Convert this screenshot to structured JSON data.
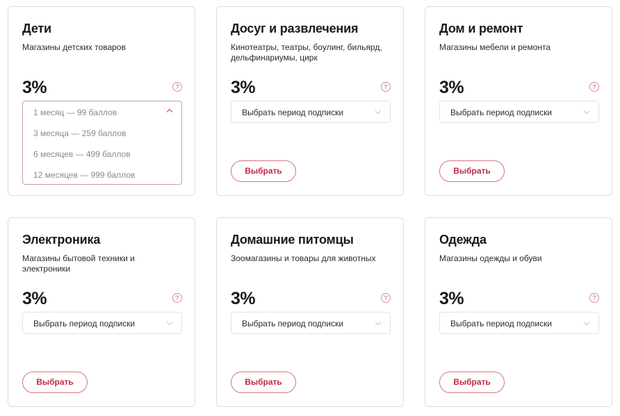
{
  "cards": [
    {
      "title": "Дети",
      "description": "Магазины детских товаров",
      "percent": "3%",
      "help_icon": "?",
      "dropdown": {
        "open": true,
        "selected": "1 месяц — 99 баллов",
        "options": [
          "3 месяца — 259 баллов",
          "6 месяцев — 499 баллов",
          "12 месяцев — 999 баллов"
        ]
      }
    },
    {
      "title": "Досуг и развлечения",
      "description": "Кинотеатры, театры, боулинг, бильярд, дельфинариумы, цирк",
      "percent": "3%",
      "help_icon": "?",
      "select_placeholder": "Выбрать период подписки",
      "button_label": "Выбрать"
    },
    {
      "title": "Дом и ремонт",
      "description": "Магазины мебели и ремонта",
      "percent": "3%",
      "help_icon": "?",
      "select_placeholder": "Выбрать период подписки",
      "button_label": "Выбрать"
    },
    {
      "title": "Электроника",
      "description": "Магазины бытовой техники и электроники",
      "percent": "3%",
      "help_icon": "?",
      "select_placeholder": "Выбрать период подписки",
      "button_label": "Выбрать"
    },
    {
      "title": "Домашние питомцы",
      "description": "Зоомагазины и товары для животных",
      "percent": "3%",
      "help_icon": "?",
      "select_placeholder": "Выбрать период подписки",
      "button_label": "Выбрать"
    },
    {
      "title": "Одежда",
      "description": "Магазины одежды и обуви",
      "percent": "3%",
      "help_icon": "?",
      "select_placeholder": "Выбрать период подписки",
      "button_label": "Выбрать"
    }
  ],
  "colors": {
    "accent": "#c3283f",
    "button_border": "#d6737f",
    "card_border": "#dcdcdc",
    "help_icon": "#d98a96"
  }
}
